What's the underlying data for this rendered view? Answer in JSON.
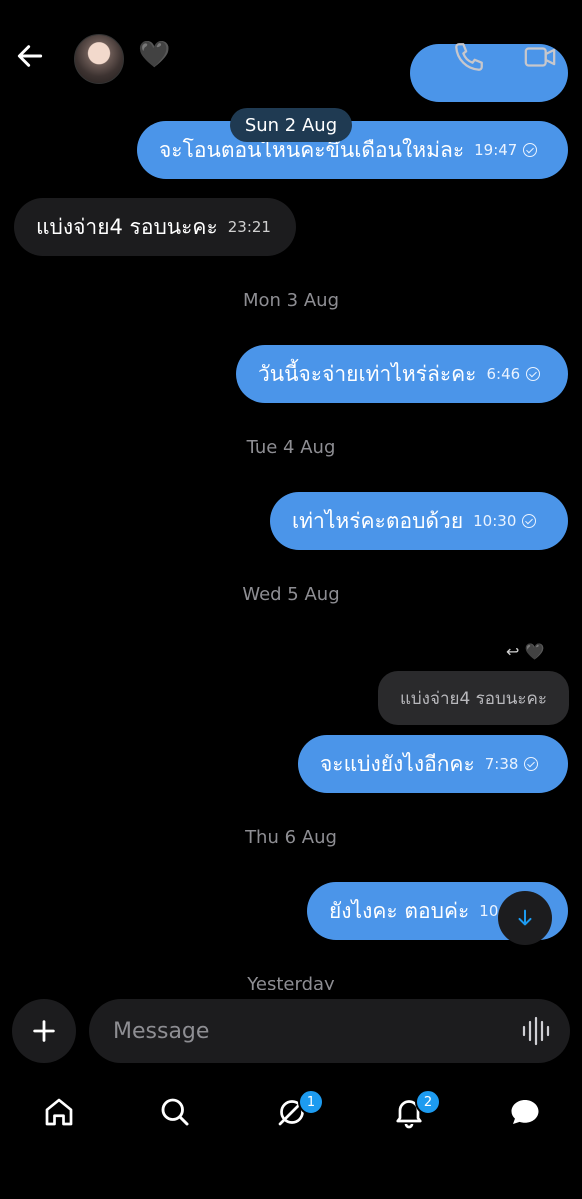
{
  "header": {
    "contact_heart": "🖤"
  },
  "messages": {
    "sticky_date": "Sun 2 Aug",
    "items": [
      {
        "text": "จะโอนตอนไหนคะขึ้นเดือนใหม่ละ",
        "time": "19:47",
        "dir": "out"
      },
      {
        "text": "แบ่งจ่าย4 รอบนะคะ",
        "time": "23:21",
        "dir": "in"
      },
      {
        "day": "Mon 3 Aug"
      },
      {
        "text": "วันนี้จะจ่ายเท่าไหร่ล่ะคะ",
        "time": "6:46",
        "dir": "out"
      },
      {
        "day": "Tue 4 Aug"
      },
      {
        "text": "เท่าไหร่คะตอบด้วย",
        "time": "10:30",
        "dir": "out"
      },
      {
        "day": "Wed 5 Aug"
      },
      {
        "reply_quote": "แบ่งจ่าย4 รอบนะคะ"
      },
      {
        "text": "จะแบ่งยังไงอีกคะ",
        "time": "7:38",
        "dir": "out"
      },
      {
        "day": "Thu 6 Aug"
      },
      {
        "text": "ยังไงคะ ตอบค่ะ",
        "time": "10",
        "dir": "out"
      },
      {
        "day": "Yesterday"
      }
    ],
    "reply_indicator": "↩ 🖤"
  },
  "composer": {
    "placeholder": "Message"
  },
  "tabbar": {
    "items": [
      "home-icon",
      "search-icon",
      "grok-icon",
      "notifications-icon",
      "messages-icon"
    ],
    "badges": {
      "grok": "1",
      "notifications": "2"
    }
  },
  "colors": {
    "outgoing_bubble": "#4b95e9",
    "incoming_bubble": "#1c1c1e",
    "badge": "#1d9bf0"
  }
}
